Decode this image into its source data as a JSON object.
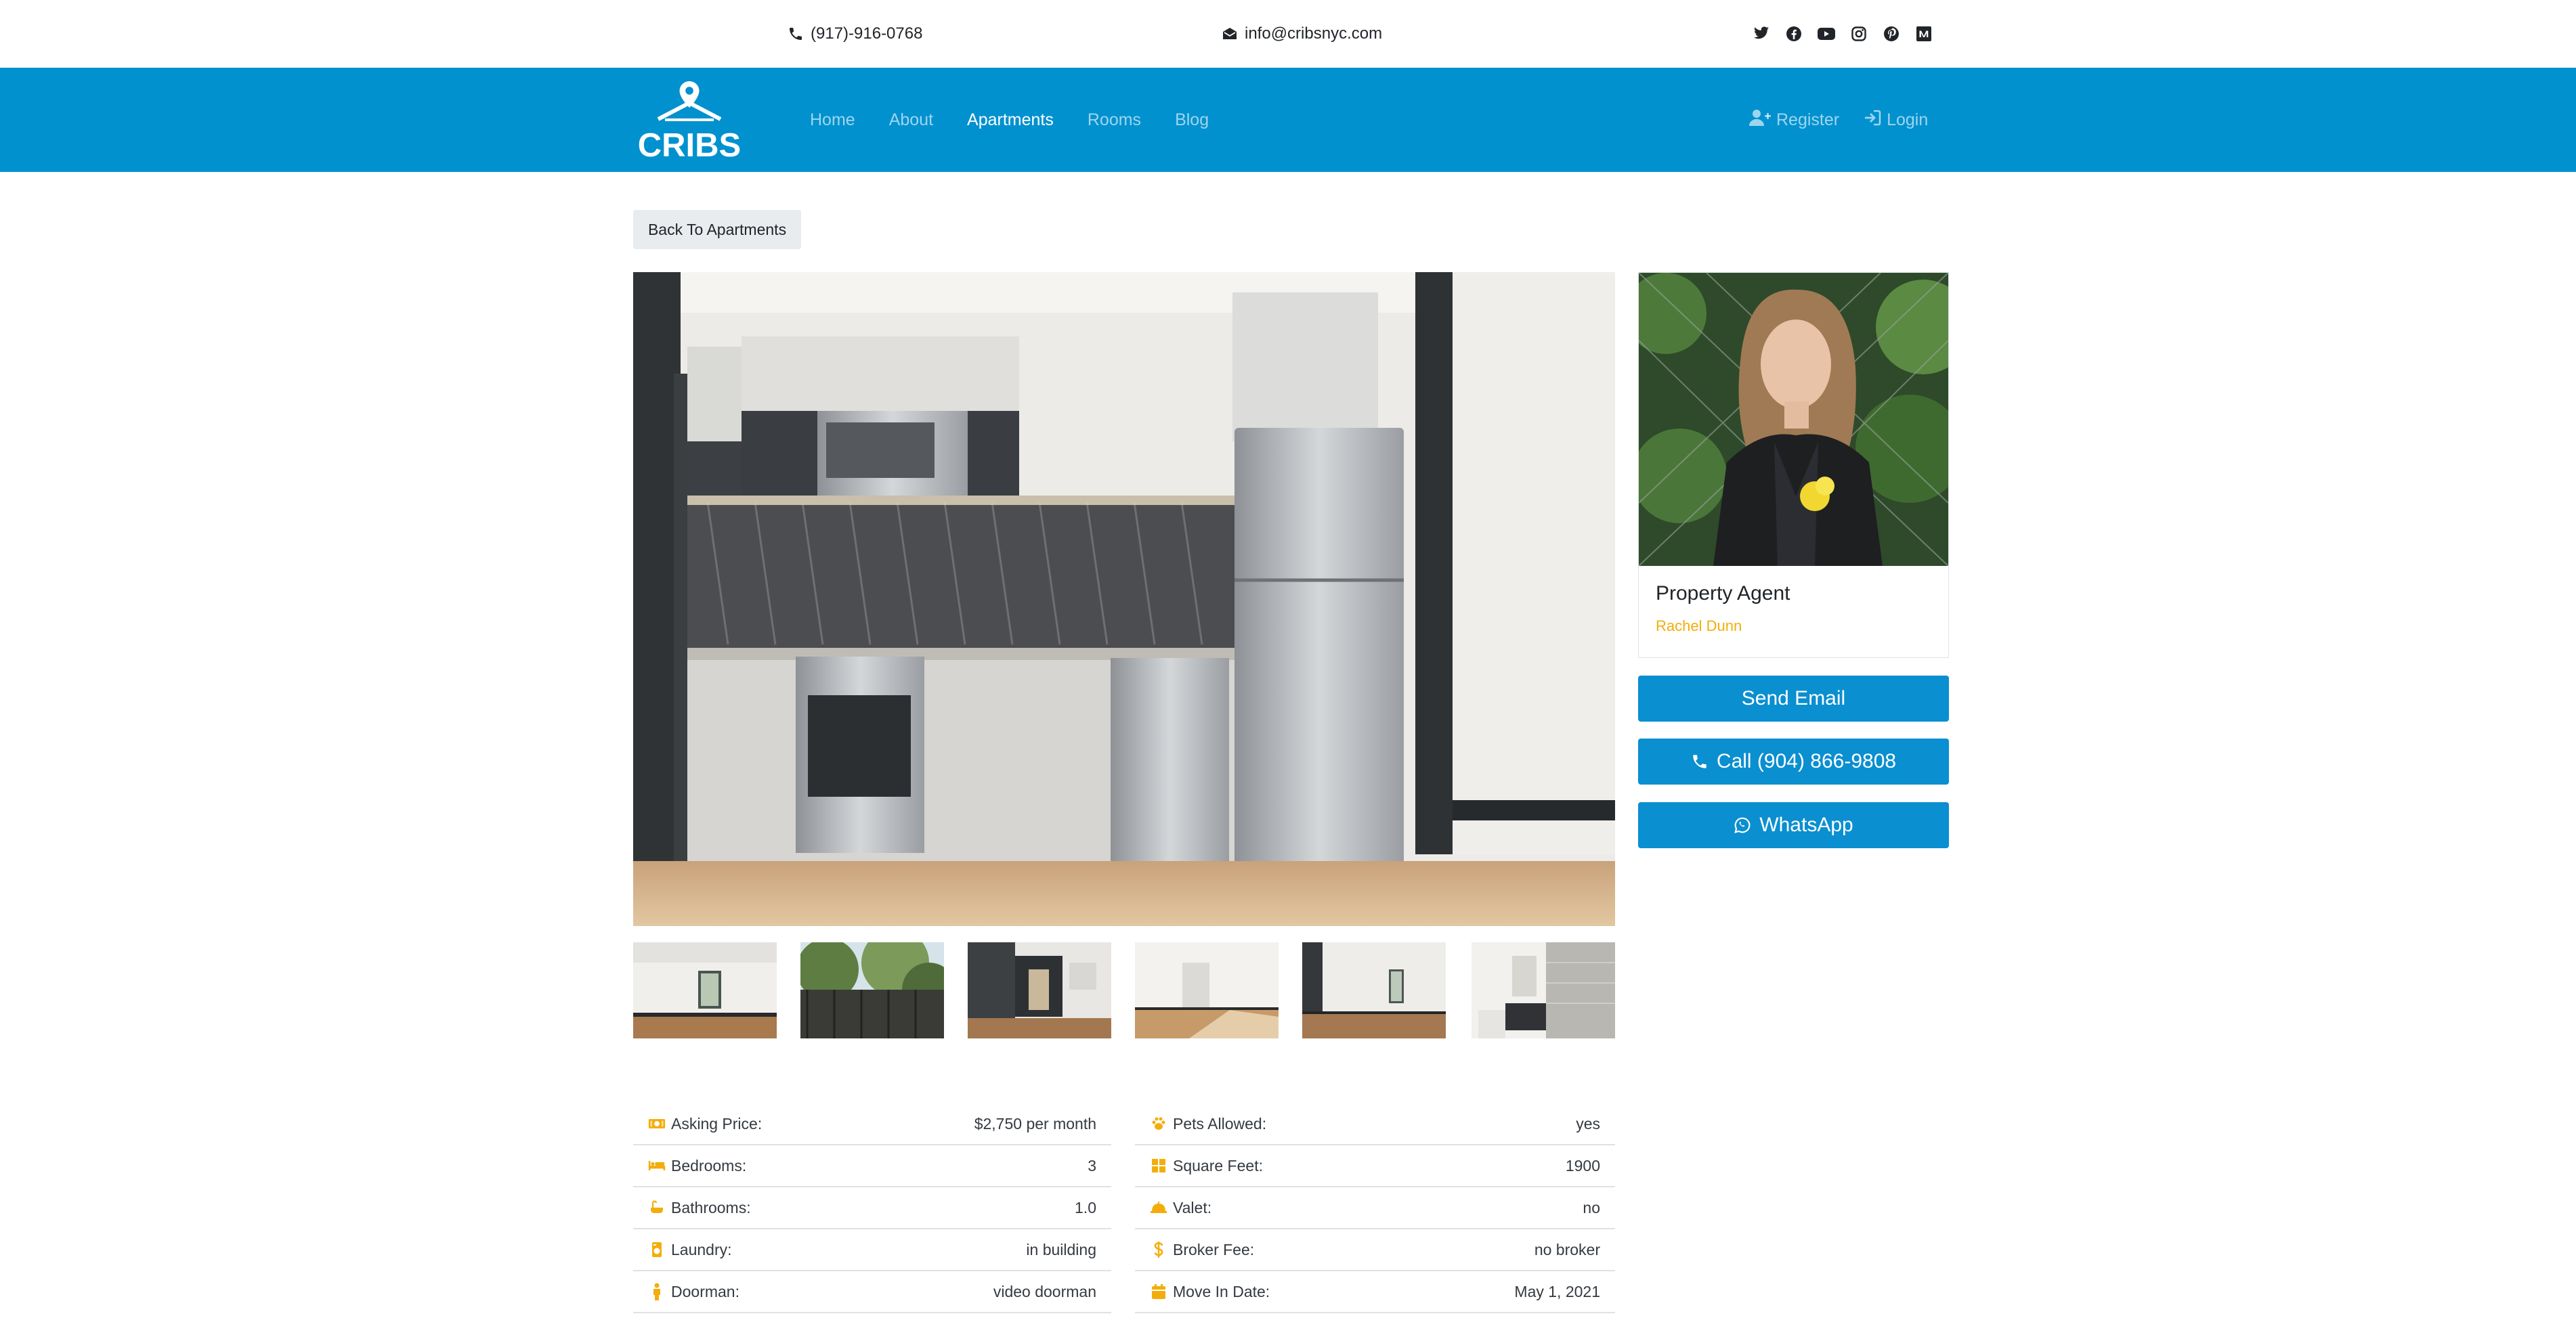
{
  "topbar": {
    "phone": "(917)-916-0768",
    "email": "info@cribsnyc.com",
    "social_icons": [
      "twitter-icon",
      "facebook-icon",
      "youtube-icon",
      "instagram-icon",
      "pinterest-icon",
      "medium-icon"
    ]
  },
  "nav": {
    "logo_text": "CRIBS",
    "items": [
      "Home",
      "About",
      "Apartments",
      "Rooms",
      "Blog"
    ],
    "active": "Apartments",
    "register": "Register",
    "login": "Login"
  },
  "back_label": "Back To Apartments",
  "agent": {
    "title": "Property Agent",
    "name": "Rachel Dunn",
    "email_btn": "Send Email",
    "call_btn": "Call (904) 866-9808",
    "whatsapp_btn": "WhatsApp"
  },
  "details_left": [
    {
      "label": "Asking Price:",
      "value": "$2,750 per month",
      "icon": "money-icon"
    },
    {
      "label": "Bedrooms:",
      "value": "3",
      "icon": "bed-icon"
    },
    {
      "label": "Bathrooms:",
      "value": "1.0",
      "icon": "bath-icon"
    },
    {
      "label": "Laundry:",
      "value": "in building",
      "icon": "laundry-icon"
    },
    {
      "label": "Doorman:",
      "value": "video doorman",
      "icon": "doorman-icon"
    }
  ],
  "details_right": [
    {
      "label": "Pets Allowed:",
      "value": "yes",
      "icon": "paw-icon"
    },
    {
      "label": "Square Feet:",
      "value": "1900",
      "icon": "grid-icon"
    },
    {
      "label": "Valet:",
      "value": "no",
      "icon": "valet-icon"
    },
    {
      "label": "Broker Fee:",
      "value": "no broker",
      "icon": "dollar-icon"
    },
    {
      "label": "Move In Date:",
      "value": "May 1, 2021",
      "icon": "calendar-icon"
    }
  ],
  "colors": {
    "brand_blue": "#0191cf",
    "button_blue": "#0a8fd0",
    "accent_gold": "#f3ad0b"
  }
}
